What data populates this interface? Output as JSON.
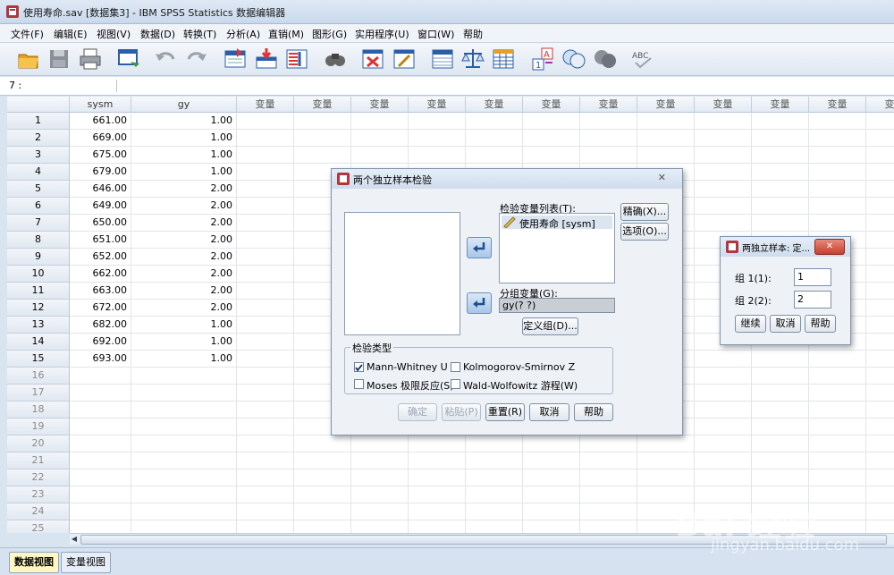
{
  "window": {
    "title": "使用寿命.sav [数据集3] - IBM SPSS Statistics 数据编辑器"
  },
  "menu": [
    "文件(F)",
    "编辑(E)",
    "视图(V)",
    "数据(D)",
    "转换(T)",
    "分析(A)",
    "直销(M)",
    "图形(G)",
    "实用程序(U)",
    "窗口(W)",
    "帮助"
  ],
  "toolbar_icons": [
    "open-icon",
    "save-icon",
    "print-icon",
    "dialog-recall-icon",
    "undo-icon",
    "redo-icon",
    "goto-case-icon",
    "goto-variable-icon",
    "variables-icon",
    "find-icon",
    "insert-cases-icon",
    "insert-variable-icon",
    "split-file-icon",
    "weight-cases-icon",
    "select-cases-icon",
    "value-labels-icon",
    "use-sets-icon",
    "show-all-icon",
    "spell-check-icon"
  ],
  "cell_reference": "7 :",
  "grid": {
    "columns": [
      "sysm",
      "gy",
      "变量",
      "变量",
      "变量",
      "变量",
      "变量",
      "变量",
      "变量",
      "变量",
      "变量",
      "变量",
      "变量",
      "变量"
    ],
    "rows": [
      [
        "661.00",
        "1.00"
      ],
      [
        "669.00",
        "1.00"
      ],
      [
        "675.00",
        "1.00"
      ],
      [
        "679.00",
        "1.00"
      ],
      [
        "646.00",
        "2.00"
      ],
      [
        "649.00",
        "2.00"
      ],
      [
        "650.00",
        "2.00"
      ],
      [
        "651.00",
        "2.00"
      ],
      [
        "652.00",
        "2.00"
      ],
      [
        "662.00",
        "2.00"
      ],
      [
        "663.00",
        "2.00"
      ],
      [
        "672.00",
        "2.00"
      ],
      [
        "682.00",
        "1.00"
      ],
      [
        "692.00",
        "1.00"
      ],
      [
        "693.00",
        "1.00"
      ]
    ],
    "row_numbers": [
      "1",
      "2",
      "3",
      "4",
      "5",
      "6",
      "7",
      "8",
      "9",
      "10",
      "11",
      "12",
      "13",
      "14",
      "15",
      "16",
      "17",
      "18",
      "19",
      "20",
      "21",
      "22",
      "23",
      "24",
      "25"
    ]
  },
  "tabs": {
    "data_view": "数据视图",
    "variable_view": "变量视图"
  },
  "dialog_main": {
    "title": "两个独立样本检验",
    "test_var_list_label": "检验变量列表(T):",
    "test_var_item": "使用寿命 [sysm]",
    "grouping_var_label": "分组变量(G):",
    "grouping_var_value": "gy(? ?)",
    "define_groups": "定义组(D)...",
    "exact": "精确(X)...",
    "options": "选项(O)...",
    "test_type_label": "检验类型",
    "tests": [
      {
        "label": "Mann-Whitney U",
        "checked": true
      },
      {
        "label": "Kolmogorov-Smirnov Z",
        "checked": false
      },
      {
        "label": "Moses 极限反应(S)",
        "checked": false
      },
      {
        "label": "Wald-Wolfowitz 游程(W)",
        "checked": false
      }
    ],
    "ok": "确定",
    "paste": "粘贴(P)",
    "reset": "重置(R)",
    "cancel": "取消",
    "help": "帮助",
    "close": "✕"
  },
  "dialog_define": {
    "title": "两独立样本: 定...",
    "group1_label": "组 1(1):",
    "group1_value": "1",
    "group2_label": "组 2(2):",
    "group2_value": "2",
    "continue": "继续",
    "cancel": "取消",
    "help": "帮助",
    "close": "✕"
  },
  "watermark": {
    "logo": "Bai 经验",
    "url": "jingyan.baidu.com"
  }
}
